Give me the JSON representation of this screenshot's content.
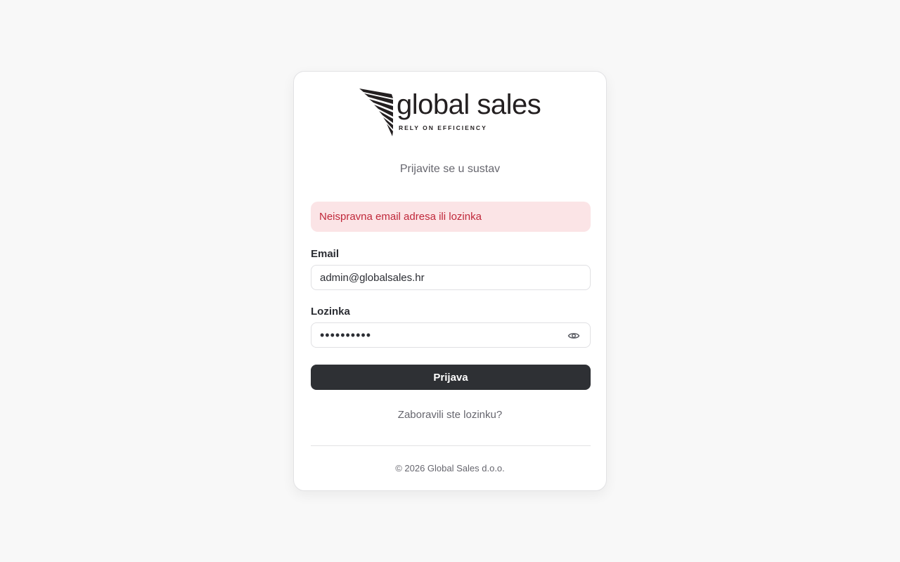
{
  "logo": {
    "wordmark": "global sales",
    "tagline": "RELY ON EFFICIENCY",
    "color": "#231f20"
  },
  "login": {
    "subtitle": "Prijavite se u sustav",
    "error_message": "Neispravna email adresa ili lozinka",
    "email_label": "Email",
    "email_value": "admin@globalsales.hr",
    "password_label": "Lozinka",
    "password_value": "••••••••••",
    "password_toggle_icon": "eye-icon",
    "submit_label": "Prijava",
    "forgot_link": "Zaboravili ste lozinku?"
  },
  "footer": {
    "copyright": "© 2026 Global Sales d.o.o."
  },
  "colors": {
    "background": "#f8f8f8",
    "error_bg": "#fbe4e6",
    "error_text": "#c0283a",
    "button_bg": "#2e3034"
  }
}
